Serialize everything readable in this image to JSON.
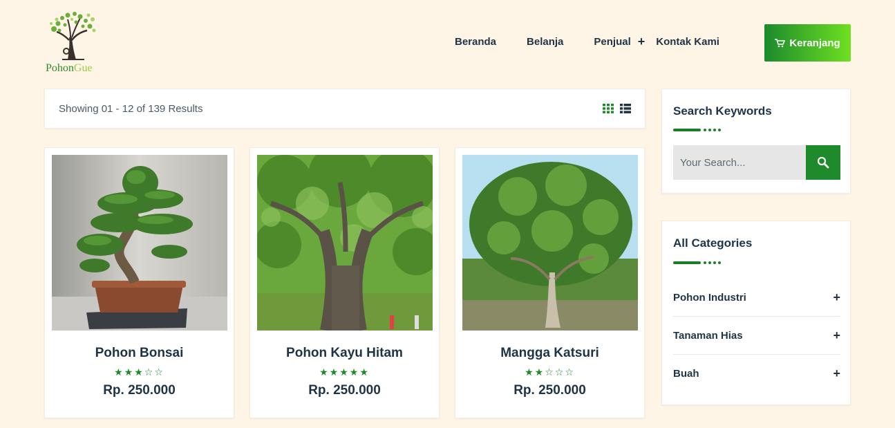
{
  "brand": {
    "name_part1": "Pohon",
    "name_part2": "Gue"
  },
  "nav": {
    "items": [
      {
        "label": "Beranda"
      },
      {
        "label": "Belanja"
      },
      {
        "label": "Penjual"
      },
      {
        "label": "Kontak Kami"
      }
    ],
    "cart_label": "Keranjang",
    "cart_icon": "cart-icon"
  },
  "results": {
    "text": "Showing 01 - 12 of 139 Results"
  },
  "products": [
    {
      "name": "Pohon Bonsai",
      "rating": 3,
      "max_rating": 5,
      "price": "Rp. 250.000"
    },
    {
      "name": "Pohon Kayu Hitam",
      "rating": 5,
      "max_rating": 5,
      "price": "Rp. 250.000"
    },
    {
      "name": "Mangga Katsuri",
      "rating": 2,
      "max_rating": 5,
      "price": "Rp. 250.000"
    }
  ],
  "sidebar": {
    "search": {
      "title": "Search Keywords",
      "placeholder": "Your Search..."
    },
    "categories": {
      "title": "All Categories",
      "items": [
        {
          "label": "Pohon Industri"
        },
        {
          "label": "Tanaman Hias"
        },
        {
          "label": "Buah"
        }
      ]
    }
  },
  "colors": {
    "accent": "#1f8a2c",
    "background": "#fef5e7",
    "text": "#1e3446"
  }
}
